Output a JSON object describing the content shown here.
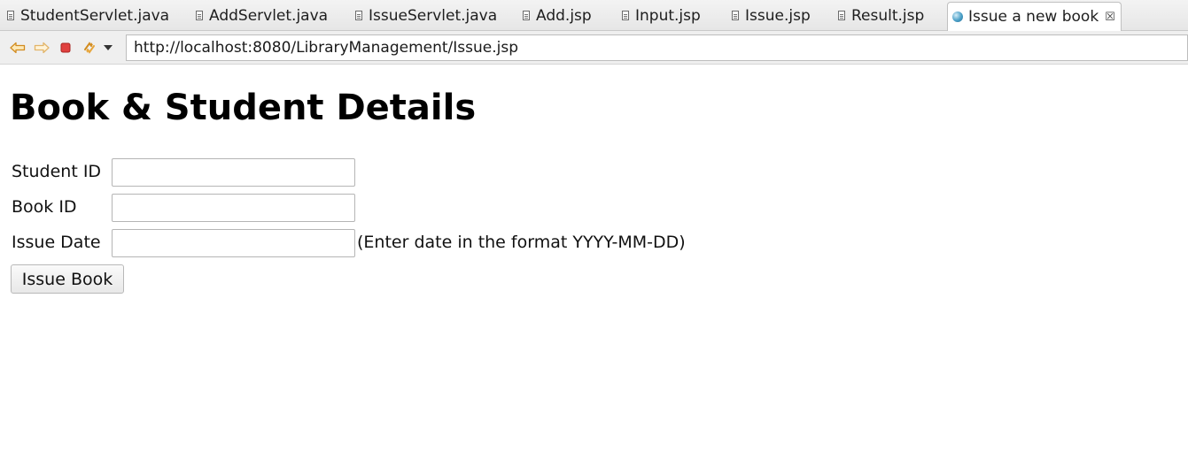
{
  "tabs": [
    {
      "label": "StudentServlet.java",
      "icon": "java-file-icon"
    },
    {
      "label": "AddServlet.java",
      "icon": "java-file-icon"
    },
    {
      "label": "IssueServlet.java",
      "icon": "java-file-icon"
    },
    {
      "label": "Add.jsp",
      "icon": "jsp-file-icon"
    },
    {
      "label": "Input.jsp",
      "icon": "jsp-file-icon"
    },
    {
      "label": "Issue.jsp",
      "icon": "jsp-file-icon"
    },
    {
      "label": "Result.jsp",
      "icon": "jsp-file-icon"
    },
    {
      "label": "Issue a new book",
      "icon": "globe-icon",
      "active": true,
      "close_icon": "close-icon"
    }
  ],
  "toolbar": {
    "back_icon": "back-arrow-icon",
    "forward_icon": "forward-arrow-icon",
    "stop_icon": "stop-icon",
    "refresh_icon": "refresh-icon",
    "dropdown_icon": "dropdown-arrow-icon",
    "url": "http://localhost:8080/LibraryManagement/Issue.jsp"
  },
  "page": {
    "title": "Book & Student Details",
    "form": {
      "student_id_label": "Student ID",
      "student_id_value": "",
      "book_id_label": "Book ID",
      "book_id_value": "",
      "issue_date_label": "Issue Date",
      "issue_date_value": "",
      "issue_date_hint": "(Enter date in the format YYYY-MM-DD)",
      "submit_label": "Issue Book"
    }
  },
  "colors": {
    "arrow_accent": "#e7a53a",
    "stop_accent": "#d33a3a",
    "active_tab_bg": "#ffffff",
    "tabbar_bg": "#e9e9e9"
  }
}
